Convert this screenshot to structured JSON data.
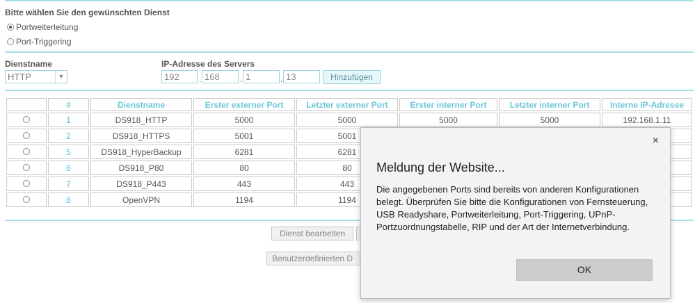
{
  "service_select": {
    "title": "Bitte wählen Sie den gewünschten Dienst",
    "options": [
      {
        "label": "Portweiterleitung",
        "checked": true
      },
      {
        "label": "Port-Triggering",
        "checked": false
      }
    ]
  },
  "form": {
    "service_name_label": "Dienstname",
    "service_name_value": "HTTP",
    "server_ip_label": "IP-Adresse des Servers",
    "ip": [
      "192",
      "168",
      "1",
      "13"
    ],
    "add_button": "Hinzufügen"
  },
  "table": {
    "headers": [
      "",
      "#",
      "Dienstname",
      "Erster externer Port",
      "Letzter externer Port",
      "Erster interner Port",
      "Letzter interner Port",
      "Interne IP-Adresse"
    ],
    "rows": [
      {
        "num": "1",
        "name": "DS918_HTTP",
        "ext_first": "5000",
        "ext_last": "5000",
        "int_first": "5000",
        "int_last": "5000",
        "ip": "192.168.1.11"
      },
      {
        "num": "2",
        "name": "DS918_HTTPS",
        "ext_first": "5001",
        "ext_last": "5001",
        "int_first": "",
        "int_last": "",
        "ip": ""
      },
      {
        "num": "5",
        "name": "DS918_HyperBackup",
        "ext_first": "6281",
        "ext_last": "6281",
        "int_first": "",
        "int_last": "",
        "ip": ""
      },
      {
        "num": "6",
        "name": "DS918_P80",
        "ext_first": "80",
        "ext_last": "80",
        "int_first": "",
        "int_last": "",
        "ip": ""
      },
      {
        "num": "7",
        "name": "DS918_P443",
        "ext_first": "443",
        "ext_last": "443",
        "int_first": "",
        "int_last": "",
        "ip": ""
      },
      {
        "num": "8",
        "name": "OpenVPN",
        "ext_first": "1194",
        "ext_last": "1194",
        "int_first": "",
        "int_last": "",
        "ip": ""
      }
    ]
  },
  "actions": {
    "edit_service": "Dienst bearbeiten",
    "custom_service": "Benutzerdefinierten D"
  },
  "dialog": {
    "close_icon": "×",
    "title": "Meldung der Website...",
    "message": "Die angegebenen Ports sind bereits von anderen Konfigurationen belegt. Überprüfen Sie bitte die Konfigurationen von Fernsteuerung, USB Readyshare, Portweiterleitung, Port-Triggering, UPnP-Portzuordnungstabelle, RIP und der Art der Internetverbindung.",
    "ok_button": "OK"
  }
}
